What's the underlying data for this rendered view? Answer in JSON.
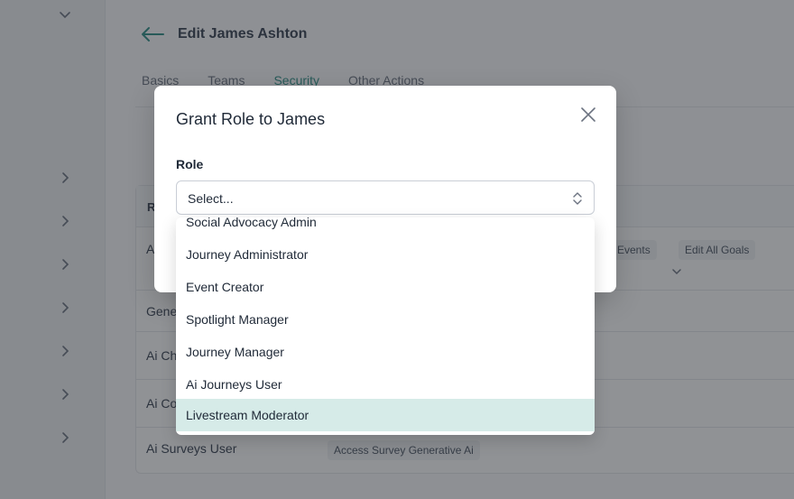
{
  "page": {
    "title": "Edit James Ashton",
    "tabs": [
      {
        "label": "Basics"
      },
      {
        "label": "Teams"
      },
      {
        "label": "Security",
        "active": true
      },
      {
        "label": "Other Actions"
      }
    ]
  },
  "table": {
    "header_label": "R",
    "rows": [
      {
        "name": "A",
        "permissions": [
          "dit Events",
          "Edit All Goals"
        ],
        "expandable": true
      },
      {
        "name": "Gene",
        "permissions": []
      },
      {
        "name": "Ai Ch",
        "permissions": []
      },
      {
        "name": "Ai Co",
        "permissions": []
      },
      {
        "name": "Ai Surveys User",
        "permissions": [
          "Access Survey Generative Ai"
        ]
      }
    ]
  },
  "modal": {
    "title": "Grant Role to James",
    "field_label": "Role",
    "select_value": "Select...",
    "close_icon": "close-icon"
  },
  "dropdown": {
    "options": [
      {
        "label": "Social Advocacy Admin"
      },
      {
        "label": "Journey Administrator"
      },
      {
        "label": "Event Creator"
      },
      {
        "label": "Spotlight Manager"
      },
      {
        "label": "Journey Manager"
      },
      {
        "label": "Ai Journeys User"
      },
      {
        "label": "Livestream Moderator",
        "highlighted": true
      }
    ]
  },
  "colors": {
    "accent": "#2f8f86",
    "highlight": "#d6ebe8",
    "overlay": "rgba(34, 38, 44, 0.5)"
  }
}
